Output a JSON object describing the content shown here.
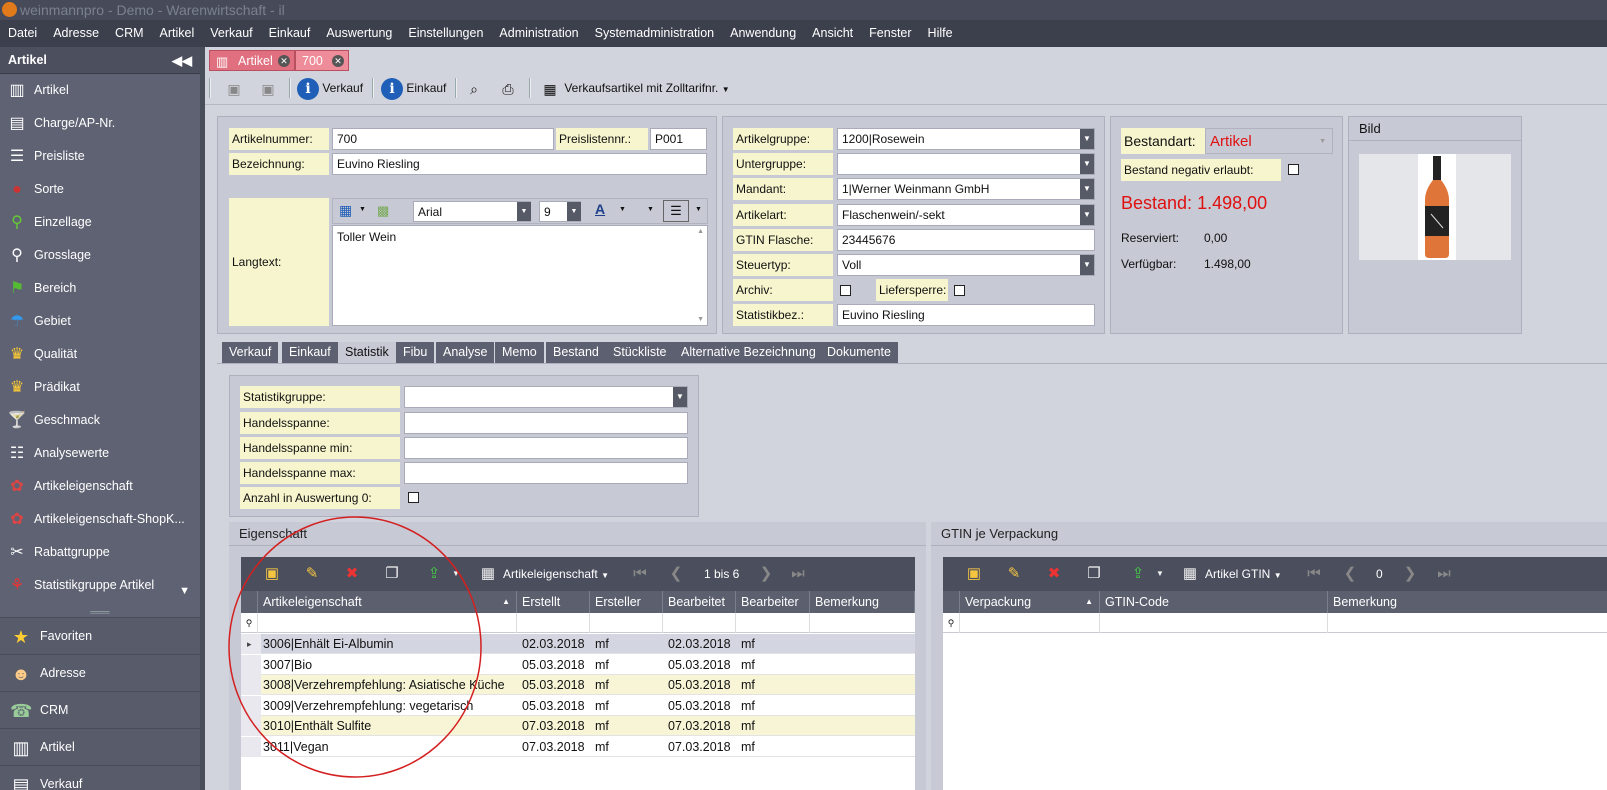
{
  "window_title": "weinmannpro - Demo - Warenwirtschaft - il",
  "menu": [
    "Datei",
    "Adresse",
    "CRM",
    "Artikel",
    "Verkauf",
    "Einkauf",
    "Auswertung",
    "Einstellungen",
    "Administration",
    "Systemadministration",
    "Anwendung",
    "Ansicht",
    "Fenster",
    "Hilfe"
  ],
  "sidebar": {
    "title": "Artikel",
    "items": [
      {
        "label": "Artikel",
        "icon": "barcode-icon"
      },
      {
        "label": "Charge/AP-Nr.",
        "icon": "bottle-label-icon"
      },
      {
        "label": "Preisliste",
        "icon": "price-list-icon"
      },
      {
        "label": "Sorte",
        "icon": "grape-icon"
      },
      {
        "label": "Einzellage",
        "icon": "pin-icon"
      },
      {
        "label": "Grosslage",
        "icon": "magnifier-icon"
      },
      {
        "label": "Bereich",
        "icon": "flag-icon"
      },
      {
        "label": "Gebiet",
        "icon": "umbrella-icon"
      },
      {
        "label": "Qualität",
        "icon": "trophy-icon"
      },
      {
        "label": "Prädikat",
        "icon": "trophy-icon"
      },
      {
        "label": "Geschmack",
        "icon": "cocktail-icon"
      },
      {
        "label": "Analysewerte",
        "icon": "list-icon"
      },
      {
        "label": "Artikeleigenschaft",
        "icon": "seal-icon"
      },
      {
        "label": "Artikeleigenschaft-ShopK...",
        "icon": "seal-icon"
      },
      {
        "label": "Rabattgruppe",
        "icon": "percent-icon"
      },
      {
        "label": "Statistikgruppe Artikel",
        "icon": "statistics-icon"
      }
    ],
    "bottom": [
      {
        "label": "Favoriten",
        "icon": "star-icon"
      },
      {
        "label": "Adresse",
        "icon": "people-icon"
      },
      {
        "label": "CRM",
        "icon": "phone-icon"
      },
      {
        "label": "Artikel",
        "icon": "barcode-icon"
      },
      {
        "label": "Verkauf",
        "icon": "invoice-icon"
      }
    ]
  },
  "doc_tabs": [
    {
      "label": "Artikel"
    },
    {
      "label": "700"
    }
  ],
  "toolbar": {
    "verkauf": "Verkauf",
    "einkauf": "Einkauf",
    "dropdown": "Verkaufsartikel mit Zolltarifnr."
  },
  "form": {
    "artikelnummer_label": "Artikelnummer:",
    "artikelnummer": "700",
    "preislistennr_label": "Preislistennr.:",
    "preislistennr": "P001",
    "bezeichnung_label": "Bezeichnung:",
    "bezeichnung": "Euvino Riesling",
    "langtext_label": "Langtext:",
    "langtext": "Toller Wein",
    "font": "Arial",
    "font_size": "9"
  },
  "details": {
    "artikelgruppe_label": "Artikelgruppe:",
    "artikelgruppe": "1200|Rosewein",
    "untergruppe_label": "Untergruppe:",
    "untergruppe": "",
    "mandant_label": "Mandant:",
    "mandant": "1|Werner Weinmann GmbH",
    "artikelart_label": "Artikelart:",
    "artikelart": "Flaschenwein/-sekt",
    "gtin_label": "GTIN Flasche:",
    "gtin": "23445676",
    "steuertyp_label": "Steuertyp:",
    "steuertyp": "Voll",
    "archiv_label": "Archiv:",
    "liefersperre_label": "Liefersperre:",
    "statistikbez_label": "Statistikbez.:",
    "statistikbez": "Euvino Riesling"
  },
  "stock": {
    "bestandart_label": "Bestandart:",
    "bestandart": "Artikel",
    "negativ_label": "Bestand negativ erlaubt:",
    "bestand_label": "Bestand:",
    "bestand": "1.498,00",
    "reserviert_label": "Reserviert:",
    "reserviert": "0,00",
    "verfuegbar_label": "Verfügbar:",
    "verfuegbar": "1.498,00"
  },
  "bild_title": "Bild",
  "tabs": [
    "Verkauf",
    "Einkauf",
    "Statistik",
    "Fibu",
    "Analyse",
    "Memo",
    "Bestand",
    "Stückliste",
    "Alternative Bezeichnung",
    "Dokumente"
  ],
  "statistik": {
    "statistikgruppe_label": "Statistikgruppe:",
    "handelsspanne_label": "Handelsspanne:",
    "handelsspanne_min_label": "Handelsspanne min:",
    "handelsspanne_max_label": "Handelsspanne max:",
    "anzahl_label": "Anzahl in Auswertung 0:"
  },
  "eigenschaft": {
    "title": "Eigenschaft",
    "view": "Artikeleigenschaft",
    "pager": "1 bis 6",
    "columns": [
      "Artikeleigenschaft",
      "Erstellt",
      "Ersteller",
      "Bearbeitet",
      "Bearbeiter",
      "Bemerkung"
    ],
    "rows": [
      [
        "3006|Enhält Ei-Albumin",
        "02.03.2018",
        "mf",
        "02.03.2018",
        "mf",
        ""
      ],
      [
        "3007|Bio",
        "05.03.2018",
        "mf",
        "05.03.2018",
        "mf",
        ""
      ],
      [
        "3008|Verzehrempfehlung: Asiatische Küche",
        "05.03.2018",
        "mf",
        "05.03.2018",
        "mf",
        ""
      ],
      [
        "3009|Verzehrempfehlung: vegetarisch",
        "05.03.2018",
        "mf",
        "05.03.2018",
        "mf",
        ""
      ],
      [
        "3010|Enthält Sulfite",
        "07.03.2018",
        "mf",
        "07.03.2018",
        "mf",
        ""
      ],
      [
        "3011|Vegan",
        "07.03.2018",
        "mf",
        "07.03.2018",
        "mf",
        ""
      ]
    ]
  },
  "gtin_panel": {
    "title": "GTIN je Verpackung",
    "view": "Artikel GTIN",
    "pager": "0",
    "columns": [
      "Verpackung",
      "GTIN-Code",
      "Bemerkung"
    ]
  },
  "colors": {
    "accent": "#e06f7f",
    "stock_red": "#e01010",
    "highlight_circle": "#d42020",
    "label_bg": "#f7f5cd"
  }
}
